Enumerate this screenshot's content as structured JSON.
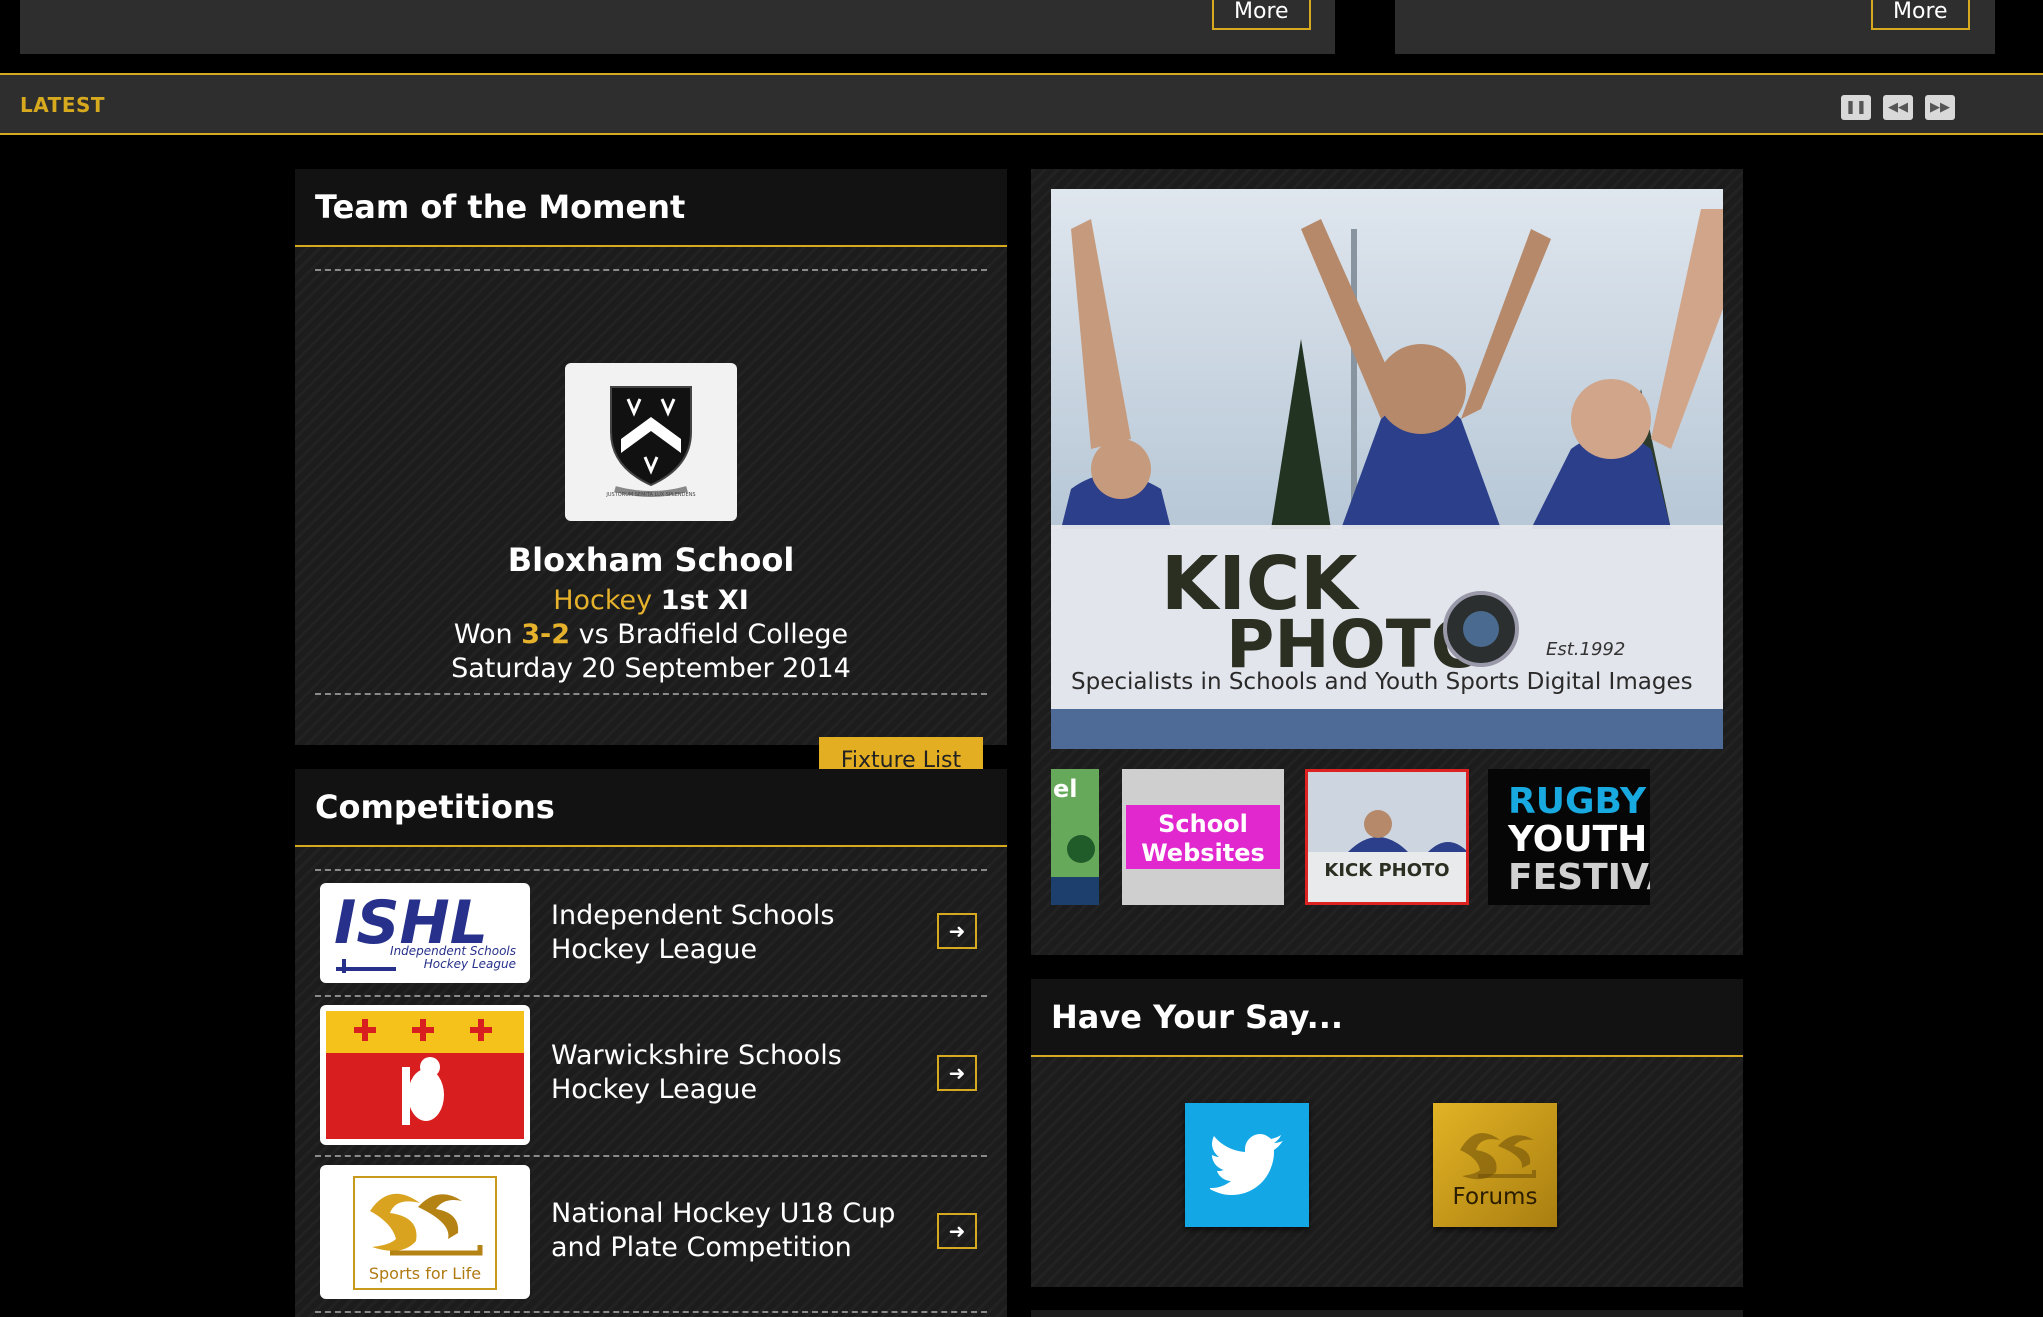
{
  "top": {
    "left_more_label": "More",
    "right_more_label": "More"
  },
  "latest": {
    "label": "LATEST",
    "controls": [
      {
        "icon": "pause-icon",
        "symbol": "❚❚"
      },
      {
        "icon": "rewind-icon",
        "symbol": "◀◀"
      },
      {
        "icon": "fast-forward-icon",
        "symbol": "▶▶"
      }
    ]
  },
  "team_of_moment": {
    "title": "Team of the Moment",
    "school": "Bloxham School",
    "sport": "Hockey",
    "team": "1st XI",
    "result_prefix": "Won",
    "score": "3-2",
    "opponent": "vs Bradfield College",
    "date": "Saturday 20 September 2014",
    "fixture_button": "Fixture List",
    "crest_motto": "JUSTORUM SEMITA LUX SPLENDENS"
  },
  "competitions": {
    "title": "Competitions",
    "items": [
      {
        "name_line1": "Independent Schools",
        "name_line2": "Hockey League",
        "logo_text": "ISHL",
        "logo_sub1": "Independent Schools",
        "logo_sub2": "Hockey League"
      },
      {
        "name_line1": "Warwickshire Schools",
        "name_line2": "Hockey League"
      },
      {
        "name_line1": "National Hockey U18 Cup",
        "name_line2": "and Plate Competition",
        "logo_text": "Sports for Life"
      }
    ]
  },
  "slider": {
    "kick": "KICK",
    "photo": "PHOTO",
    "est": "Est.1992",
    "tagline": "Specialists in Schools and Youth Sports Digital Images",
    "thumbs": [
      {
        "label": "el"
      },
      {
        "label_line1": "School",
        "label_line2": "Websites"
      },
      {
        "label": "KICK PHOTO"
      },
      {
        "label_line1": "RUGBY",
        "label_line2": "YOUTH",
        "label_line3": "FESTIVAL"
      }
    ]
  },
  "have_your_say": {
    "title": "Have Your Say...",
    "forums_label": "Forums"
  },
  "colors": {
    "accent": "#d6a91e",
    "twitter": "#14a7e6",
    "panel": "#1c1c1c"
  }
}
